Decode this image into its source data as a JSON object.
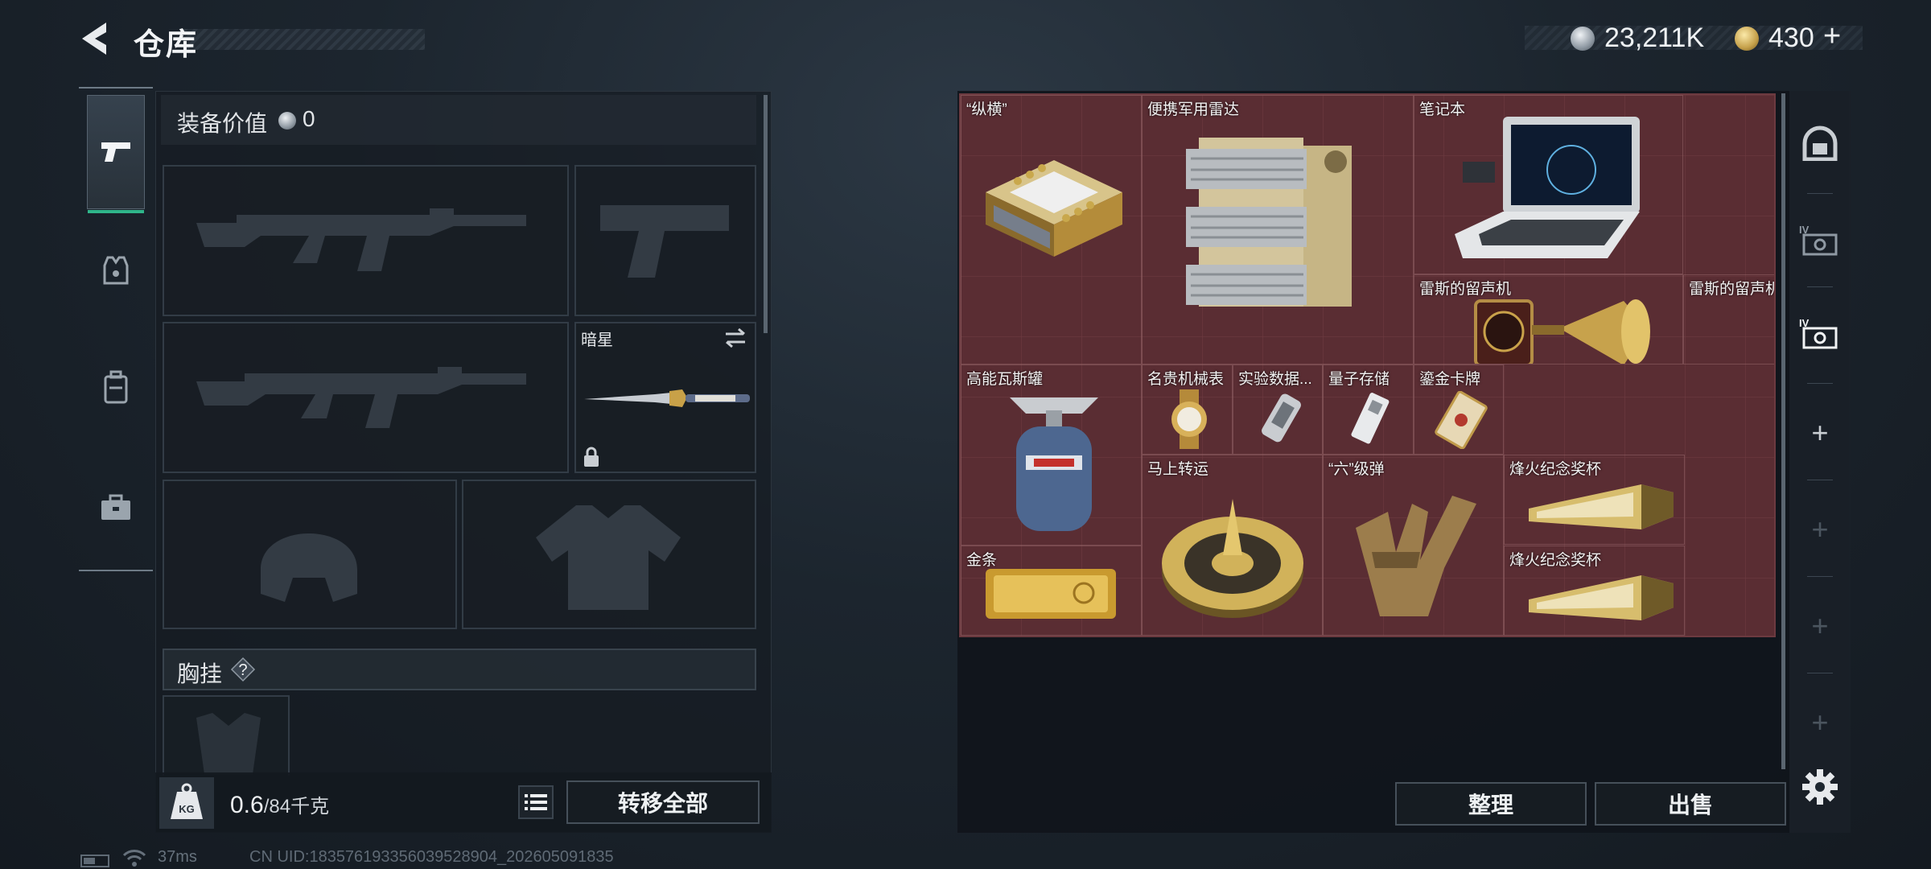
{
  "header": {
    "title": "仓库",
    "currency": {
      "coins": "23,211K",
      "premium": "430",
      "plus": "+"
    }
  },
  "rail": {
    "items": [
      {
        "name": "weapons",
        "icon": "pistol-icon",
        "active": true
      },
      {
        "name": "armor",
        "icon": "armor-icon"
      },
      {
        "name": "backpack",
        "icon": "backpack-icon"
      },
      {
        "name": "kit",
        "icon": "toolbox-icon"
      }
    ]
  },
  "loadout": {
    "value_label": "装备价值",
    "value": "0",
    "melee_name": "暗星",
    "chest_label": "胸挂",
    "chest_help": "?",
    "weight_current": "0.6",
    "weight_max": "/84千克",
    "transfer_all": "转移全部"
  },
  "warehouse": {
    "items": [
      {
        "name": "“纵横”"
      },
      {
        "name": "便携军用雷达"
      },
      {
        "name": "笔记本"
      },
      {
        "name": "雷斯的留声机"
      },
      {
        "name": "高能瓦斯罐"
      },
      {
        "name": "名贵机械表"
      },
      {
        "name": "实验数据..."
      },
      {
        "name": "量子存储"
      },
      {
        "name": "鎏金卡牌"
      },
      {
        "name": "马上转运"
      },
      {
        "name": "“六”级弹"
      },
      {
        "name": "烽火纪念奖杯"
      },
      {
        "name": "金条"
      },
      {
        "name": "烽火纪念奖杯"
      }
    ],
    "sort": "整理",
    "sell": "出售",
    "grid_color": "#5a2d33"
  },
  "right_rail": {
    "tabs": [
      {
        "icon": "safe-box-icon"
      },
      {
        "icon": "storage-iv-icon"
      },
      {
        "icon": "storage-iv-active-icon"
      },
      {
        "icon": "plus-icon",
        "label": "+"
      },
      {
        "icon": "plus-icon",
        "label": "+"
      },
      {
        "icon": "plus-icon",
        "label": "+"
      },
      {
        "icon": "plus-icon",
        "label": "+"
      }
    ]
  },
  "status": {
    "ping": "37ms",
    "uid": "CN UID:18357619335603952890​4_202605091835"
  }
}
